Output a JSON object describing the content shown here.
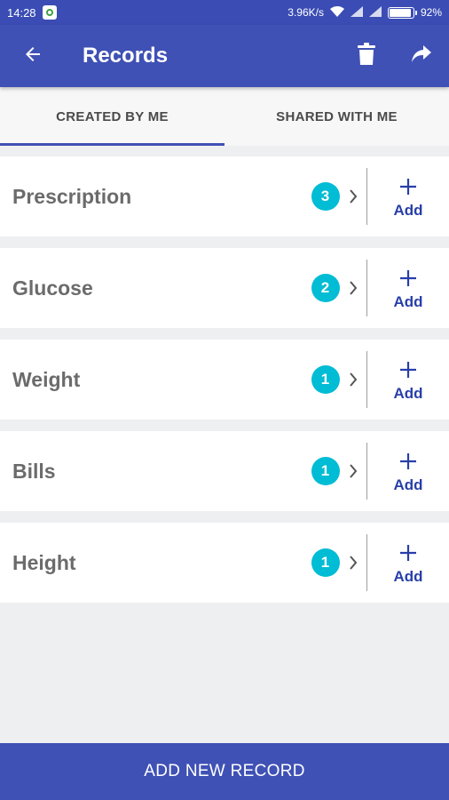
{
  "status_bar": {
    "time": "14:28",
    "network_speed": "3.96K/s",
    "battery": "92%",
    "battery_level": 0.92,
    "icons": [
      "app-notification-icon",
      "wifi-icon",
      "signal-icon",
      "signal-icon",
      "battery-icon"
    ]
  },
  "app_bar": {
    "title": "Records",
    "icons": [
      "back-arrow-icon",
      "delete-icon",
      "share-icon"
    ]
  },
  "tabs": [
    {
      "label": "CREATED BY ME",
      "selected": true
    },
    {
      "label": "SHARED WITH ME",
      "selected": false
    }
  ],
  "records": [
    {
      "label": "Prescription",
      "count": "3",
      "add_label": "Add"
    },
    {
      "label": "Glucose",
      "count": "2",
      "add_label": "Add"
    },
    {
      "label": "Weight",
      "count": "1",
      "add_label": "Add"
    },
    {
      "label": "Bills",
      "count": "1",
      "add_label": "Add"
    },
    {
      "label": "Height",
      "count": "1",
      "add_label": "Add"
    }
  ],
  "bottom_button": {
    "label": "ADD NEW RECORD"
  },
  "colors": {
    "primary": "#3f51b5",
    "badge": "#00bcd4",
    "add_text": "#283fa8",
    "background": "#eeeff1"
  }
}
